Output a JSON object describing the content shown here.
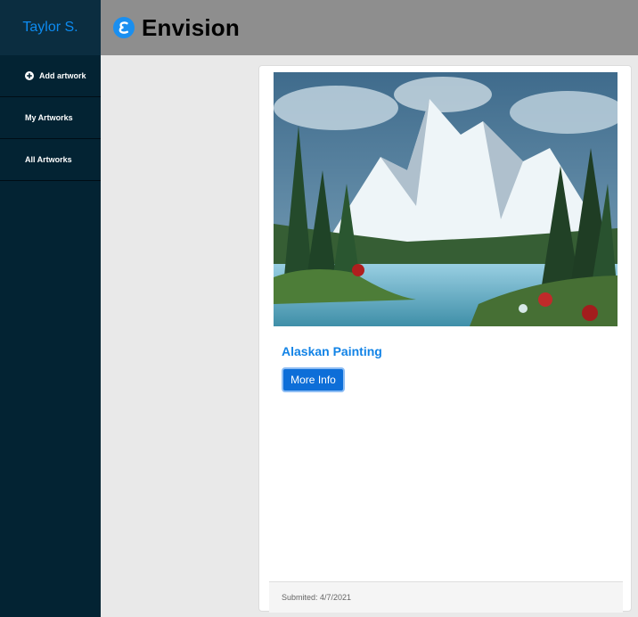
{
  "sidebar": {
    "user_name": "Taylor S.",
    "items": [
      {
        "label": "Add artwork",
        "icon": "plus-circle-icon"
      },
      {
        "label": "My Artworks"
      },
      {
        "label": "All Artworks"
      }
    ]
  },
  "header": {
    "brand": "Envision",
    "logo_icon": "envision-logo-icon"
  },
  "card": {
    "title": "Alaskan Painting",
    "more_info_label": "More Info",
    "submitted_text": "Submited: 4/7/2021",
    "image_subject": "painting-mountains-lake-trees"
  },
  "colors": {
    "sidebar_bg": "#032333",
    "header_bg": "#8e8e8e",
    "accent": "#0d6ed8",
    "title_blue": "#1283e6"
  }
}
